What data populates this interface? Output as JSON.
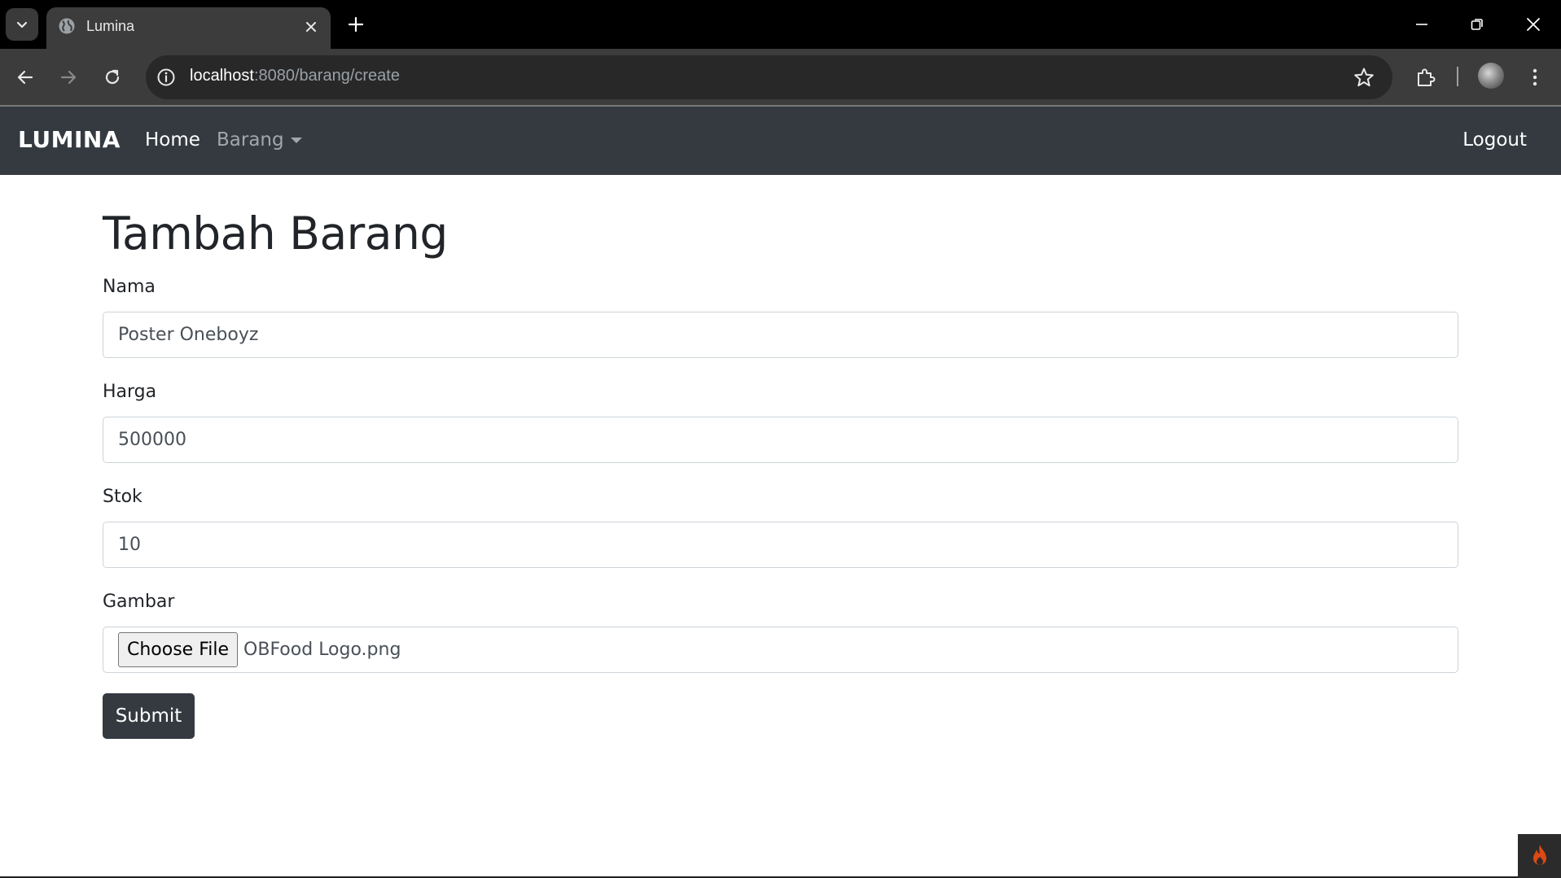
{
  "browser": {
    "tab_title": "Lumina",
    "url_host": "localhost",
    "url_path": ":8080/barang/create"
  },
  "navbar": {
    "brand": "LUMINA",
    "home": "Home",
    "barang": "Barang",
    "logout": "Logout"
  },
  "page": {
    "title": "Tambah Barang"
  },
  "form": {
    "nama": {
      "label": "Nama",
      "value": "Poster Oneboyz"
    },
    "harga": {
      "label": "Harga",
      "value": "500000"
    },
    "stok": {
      "label": "Stok",
      "value": "10"
    },
    "gambar": {
      "label": "Gambar",
      "button": "Choose File",
      "filename": "OBFood Logo.png"
    },
    "submit": "Submit"
  },
  "colors": {
    "navbar_bg": "#343a40",
    "button_dark": "#343a40"
  }
}
